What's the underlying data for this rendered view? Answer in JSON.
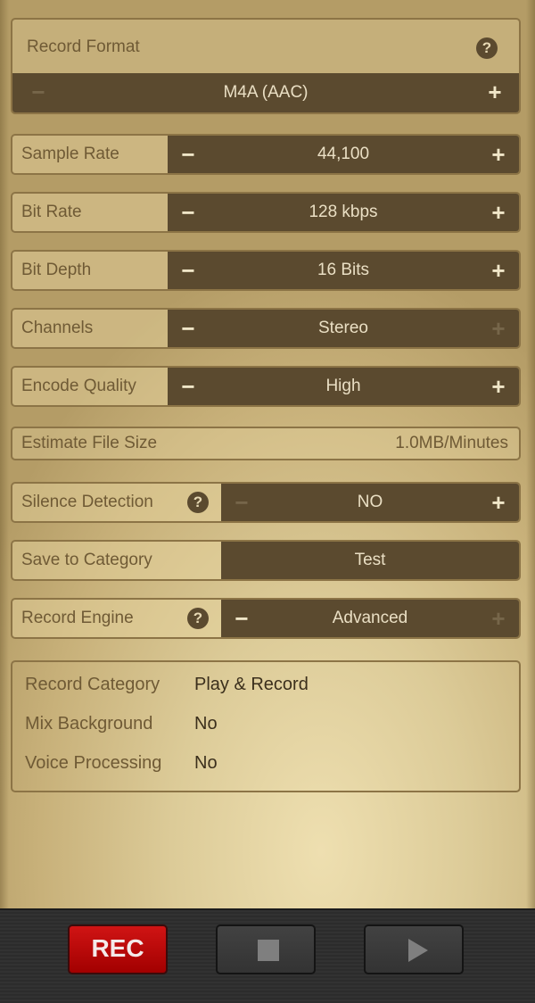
{
  "record_format": {
    "title": "Record Format",
    "help_icon": "question-circle-icon",
    "value": "M4A (AAC)",
    "minus_enabled": false,
    "plus_enabled": true
  },
  "icons": {
    "minus": "−",
    "plus": "+",
    "help": "?"
  },
  "settings": [
    {
      "label": "Sample Rate",
      "value": "44,100",
      "minus_enabled": true,
      "plus_enabled": true
    },
    {
      "label": "Bit Rate",
      "value": "128 kbps",
      "minus_enabled": true,
      "plus_enabled": true
    },
    {
      "label": "Bit Depth",
      "value": "16 Bits",
      "minus_enabled": true,
      "plus_enabled": true
    },
    {
      "label": "Channels",
      "value": "Stereo",
      "minus_enabled": true,
      "plus_enabled": false
    },
    {
      "label": "Encode Quality",
      "value": "High",
      "minus_enabled": true,
      "plus_enabled": true
    }
  ],
  "estimate_file_size": {
    "label": "Estimate File Size",
    "value": "1.0MB/Minutes"
  },
  "silence_detection": {
    "label": "Silence Detection",
    "value": "NO",
    "minus_enabled": false,
    "plus_enabled": true
  },
  "save_to_category": {
    "label": "Save to Category",
    "value": "Test"
  },
  "record_engine": {
    "label": "Record Engine",
    "value": "Advanced",
    "minus_enabled": true,
    "plus_enabled": false
  },
  "info": [
    {
      "key": "Record Category",
      "value": "Play & Record"
    },
    {
      "key": "Mix Background",
      "value": "No"
    },
    {
      "key": "Voice Processing",
      "value": "No"
    }
  ],
  "transport": {
    "rec_label": "REC",
    "stop_icon": "stop-icon",
    "play_icon": "play-icon"
  },
  "colors": {
    "panel_dark": "#5b4a2f",
    "label_text": "#6f5a35",
    "rec_red": "#c40a0a"
  }
}
